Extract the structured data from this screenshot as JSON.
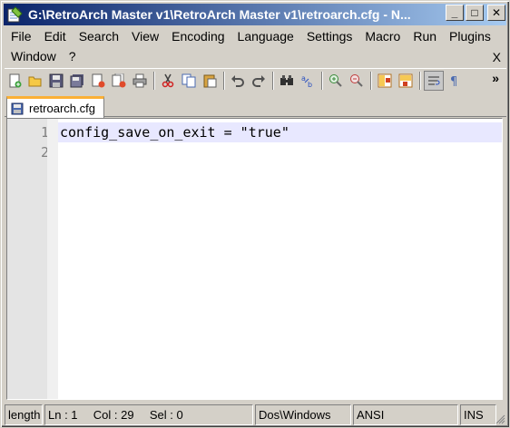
{
  "window": {
    "title": "G:\\RetroArch Master v1\\RetroArch Master v1\\retroarch.cfg - N...",
    "minimize_glyph": "_",
    "maximize_glyph": "□",
    "close_glyph": "✕"
  },
  "menu": {
    "row1": [
      "File",
      "Edit",
      "Search",
      "View",
      "Encoding",
      "Language",
      "Settings",
      "Macro",
      "Run",
      "Plugins"
    ],
    "row2": [
      "Window",
      "?"
    ],
    "close_doc": "X"
  },
  "toolbar": {
    "icons": [
      "new-file-icon",
      "open-file-icon",
      "save-icon",
      "save-all-icon",
      "close-icon",
      "close-all-icon",
      "print-icon",
      "cut-icon",
      "copy-icon",
      "paste-icon",
      "undo-icon",
      "redo-icon",
      "find-icon",
      "replace-icon",
      "zoom-in-icon",
      "zoom-out-icon",
      "sync-vertical-icon",
      "sync-horizontal-icon",
      "word-wrap-icon",
      "show-all-characters-icon"
    ],
    "more_glyph": "»"
  },
  "tabs": [
    {
      "label": "retroarch.cfg",
      "active": true
    }
  ],
  "editor": {
    "line_numbers": [
      "1",
      "2"
    ],
    "lines": [
      "config_save_on_exit = \"true\"",
      ""
    ],
    "active_line_color": "#e8e8ff"
  },
  "status": {
    "length": "length",
    "ln": "Ln : 1",
    "col": "Col : 29",
    "sel": "Sel : 0",
    "eol": "Dos\\Windows",
    "encoding": "ANSI",
    "mode": "INS"
  },
  "colors": {
    "title_start": "#0a246a",
    "title_end": "#a6caf0",
    "tab_accent": "#fbb036",
    "chrome": "#d4d0c8"
  }
}
